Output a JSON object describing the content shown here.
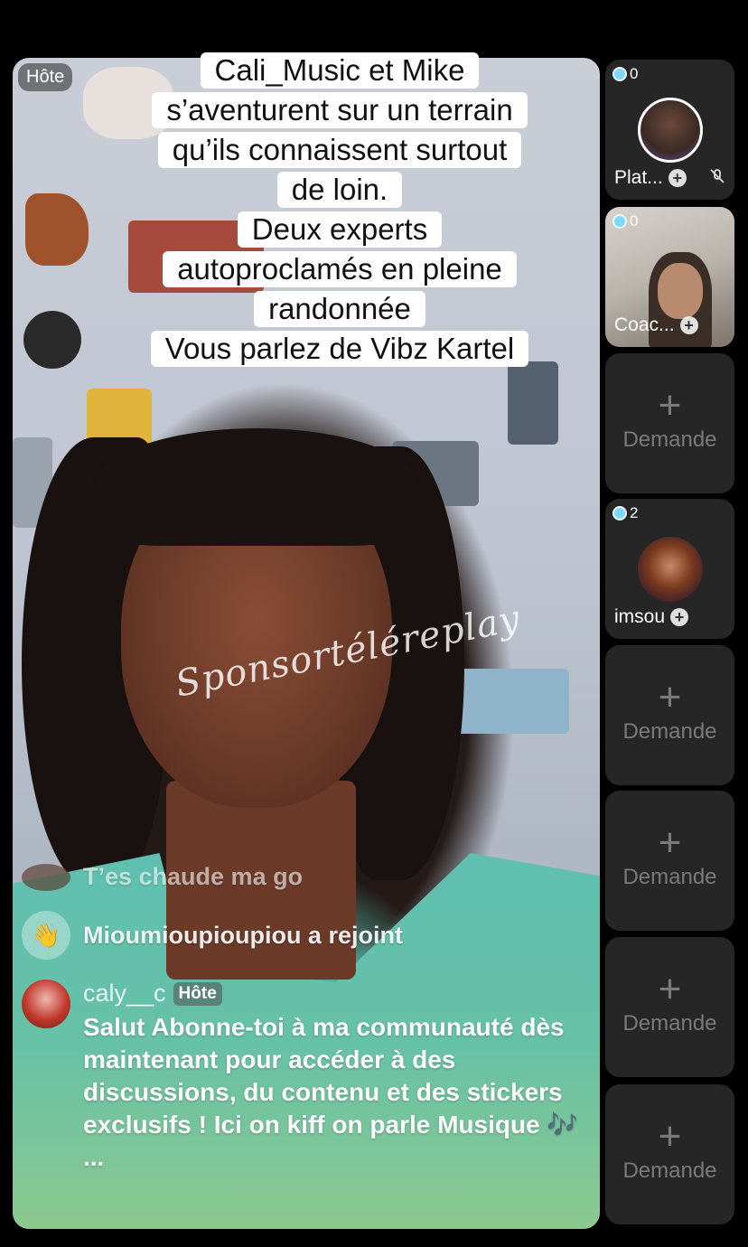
{
  "host_badge": "Hôte",
  "caption_lines": [
    "Cali_Music et Mike",
    "s’aventurent sur un terrain",
    "qu’ils connaissent surtout",
    "de loin.",
    "Deux experts",
    "autoproclamés en pleine",
    "randonnée",
    "Vous parlez de Vibz Kartel"
  ],
  "watermark": "Sponsortéléreplay",
  "chat": {
    "message1": "T’es chaude ma go",
    "join_notice": "Mioumioupioupiou a rejoint",
    "comment": {
      "user": "caly__c",
      "badge": "Hôte",
      "body": "Salut Abonne-toi à ma communauté dès maintenant pour accéder à des discussions, du contenu et des stickers exclusifs ! Ici on kiff on parle Musique 🎶 ..."
    }
  },
  "guests": [
    {
      "count": "0",
      "name": "Plat..."
    },
    {
      "count": "0",
      "name": "Coac..."
    },
    {
      "count": "2",
      "name": "imsou"
    }
  ],
  "request_label": "Demande",
  "request_plus": "+",
  "plus_symbol": "+",
  "mic_off_icon": "mic-off-icon",
  "wave_icon": "👋",
  "colors": {
    "gem": "#7fd9ff",
    "tile_bg": "#262626",
    "request_text": "#7a7a7a"
  }
}
